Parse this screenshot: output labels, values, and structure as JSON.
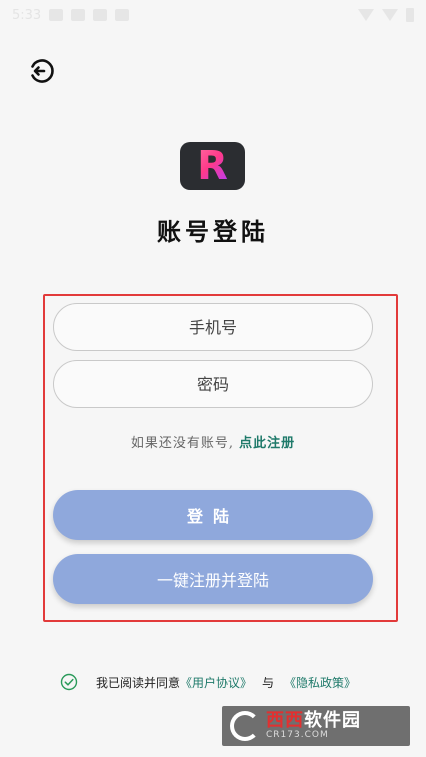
{
  "status_bar": {
    "time": "5:33"
  },
  "header": {
    "back_icon": "back-arrow-icon"
  },
  "logo": {
    "letter": "R"
  },
  "title": "账号登陆",
  "form": {
    "phone_placeholder": "手机号",
    "password_placeholder": "密码",
    "register_prompt": "如果还没有账号, ",
    "register_link": "点此注册",
    "login_label": "登陆",
    "quick_register_label": "一键注册并登陆"
  },
  "agreement": {
    "prefix": "我已阅读并同意",
    "user_agreement": "《用户协议》",
    "and": "与",
    "privacy_policy": "《隐私政策》"
  },
  "watermark": {
    "main_red": "西西",
    "main_rest": "软件园",
    "sub": "CR173.COM"
  },
  "colors": {
    "accent": "#8fa8dc",
    "link": "#1f7a6a",
    "highlight_border": "#e23a3a",
    "check": "#2a9a5a"
  }
}
